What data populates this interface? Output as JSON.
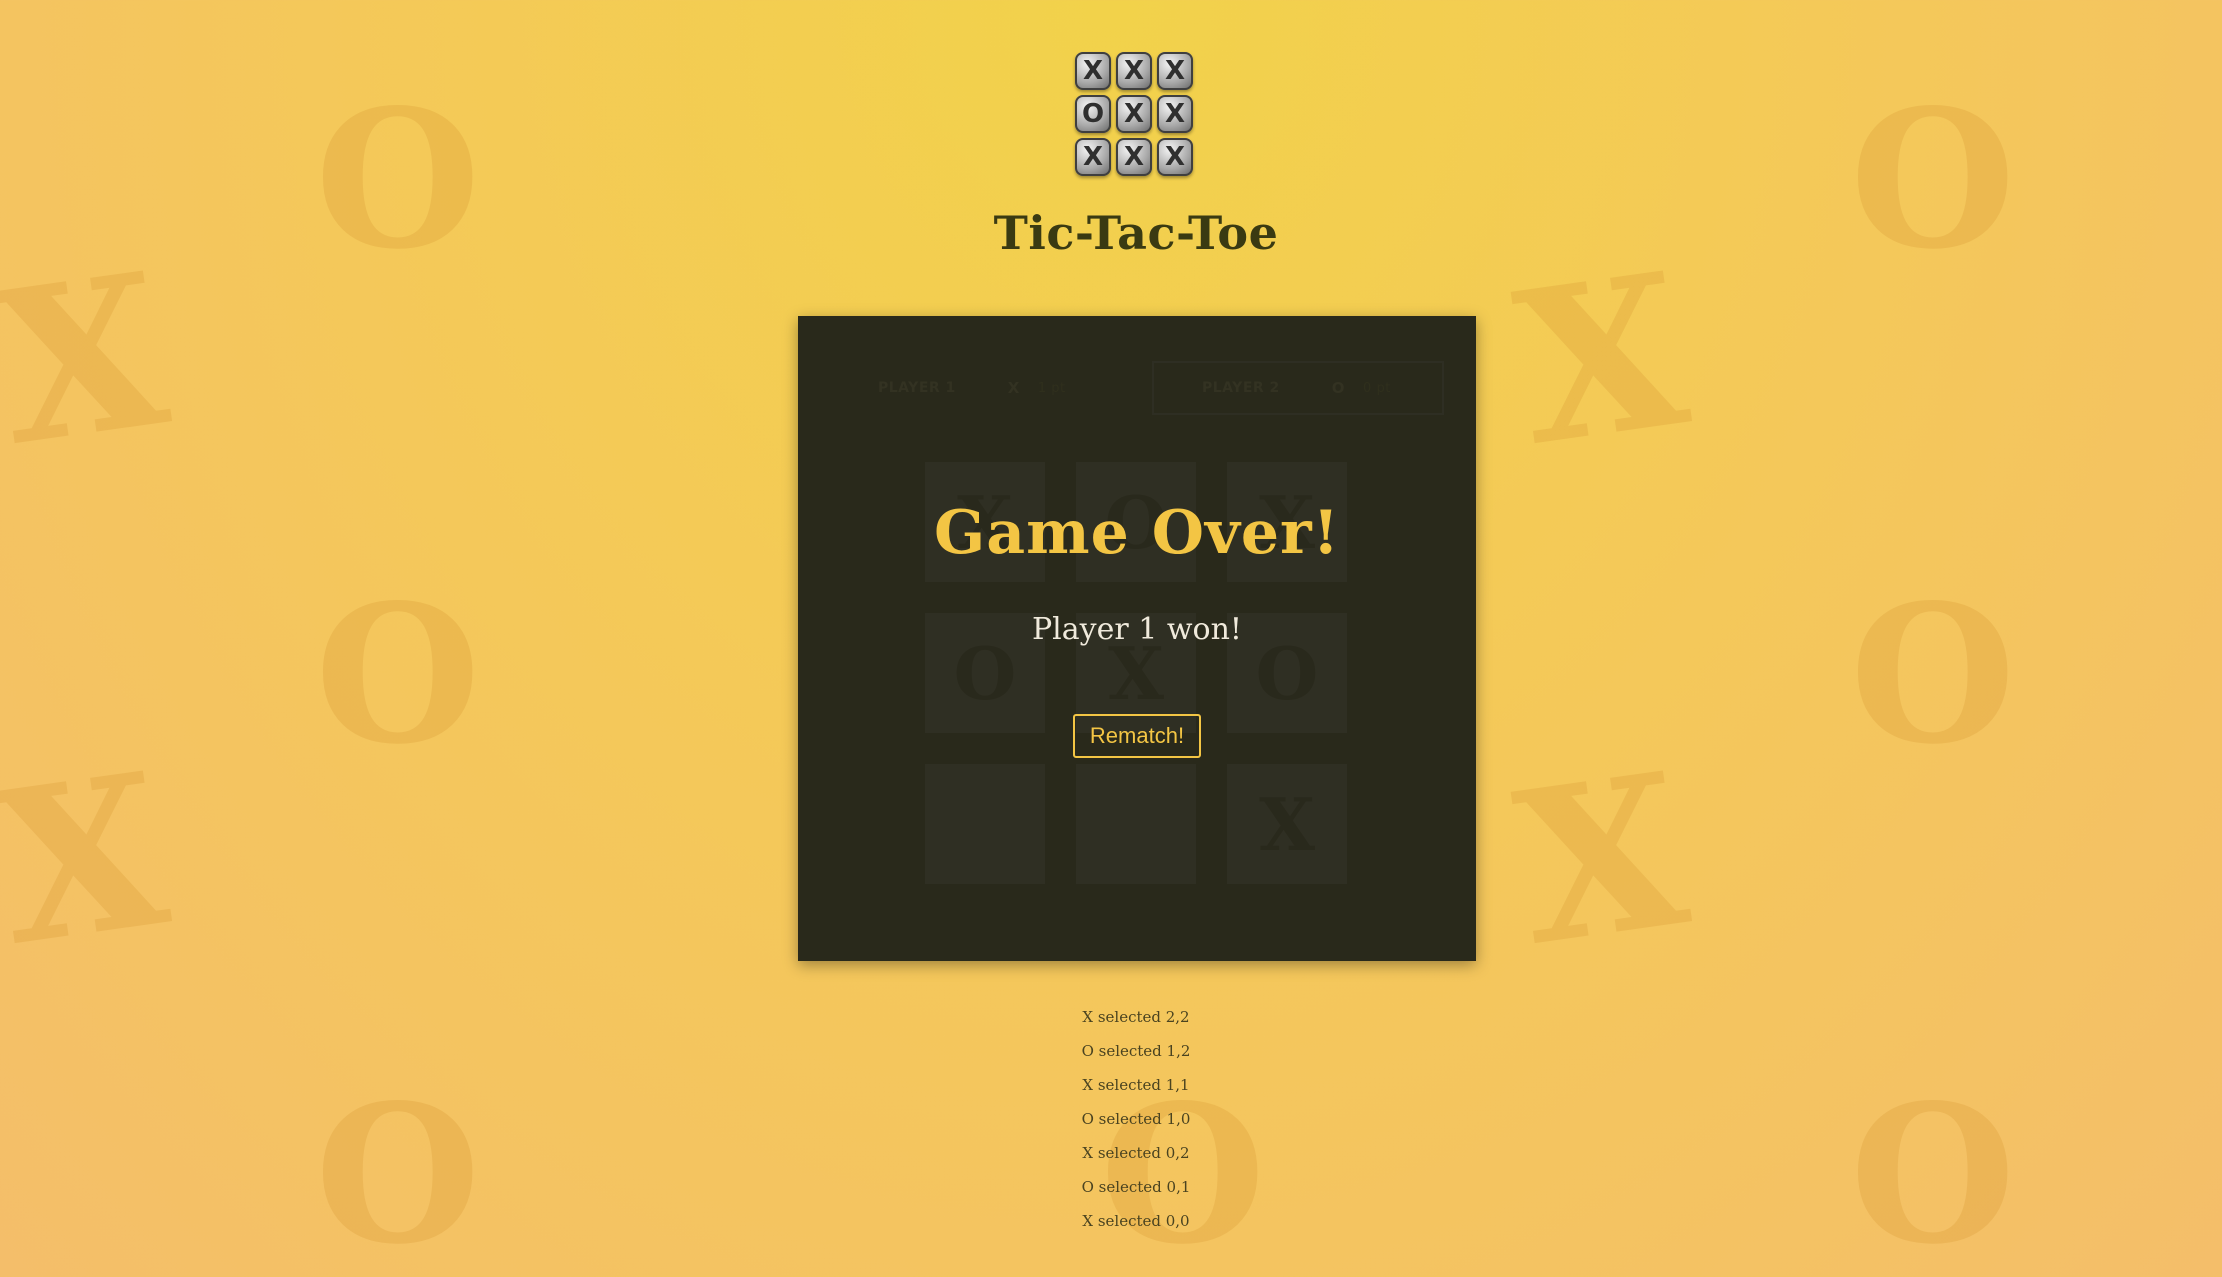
{
  "app": {
    "title": "Tic-Tac-Toe",
    "logo_tiles": [
      "X",
      "X",
      "X",
      "O",
      "X",
      "X",
      "X",
      "X",
      "X"
    ]
  },
  "background": {
    "glyphs": [
      "O",
      "X"
    ]
  },
  "scoreboard": {
    "player1": {
      "name": "PLAYER 1",
      "mark": "X",
      "score": "1 pt"
    },
    "player2": {
      "name": "PLAYER 2",
      "mark": "O",
      "score": "0 pt"
    }
  },
  "board": {
    "cells": [
      "X",
      "O",
      "X",
      "O",
      "X",
      "O",
      "",
      "",
      "X"
    ]
  },
  "game_over": {
    "title": "Game Over!",
    "message": "Player 1 won!",
    "rematch_label": "Rematch!"
  },
  "move_log": [
    "X selected 2,2",
    "O selected 1,2",
    "X selected 1,1",
    "O selected 1,0",
    "X selected 0,2",
    "O selected 0,1",
    "X selected 0,0"
  ],
  "colors": {
    "accent": "#f3c544",
    "panel": "#2a2a1c",
    "title_text": "#3a3a12"
  }
}
